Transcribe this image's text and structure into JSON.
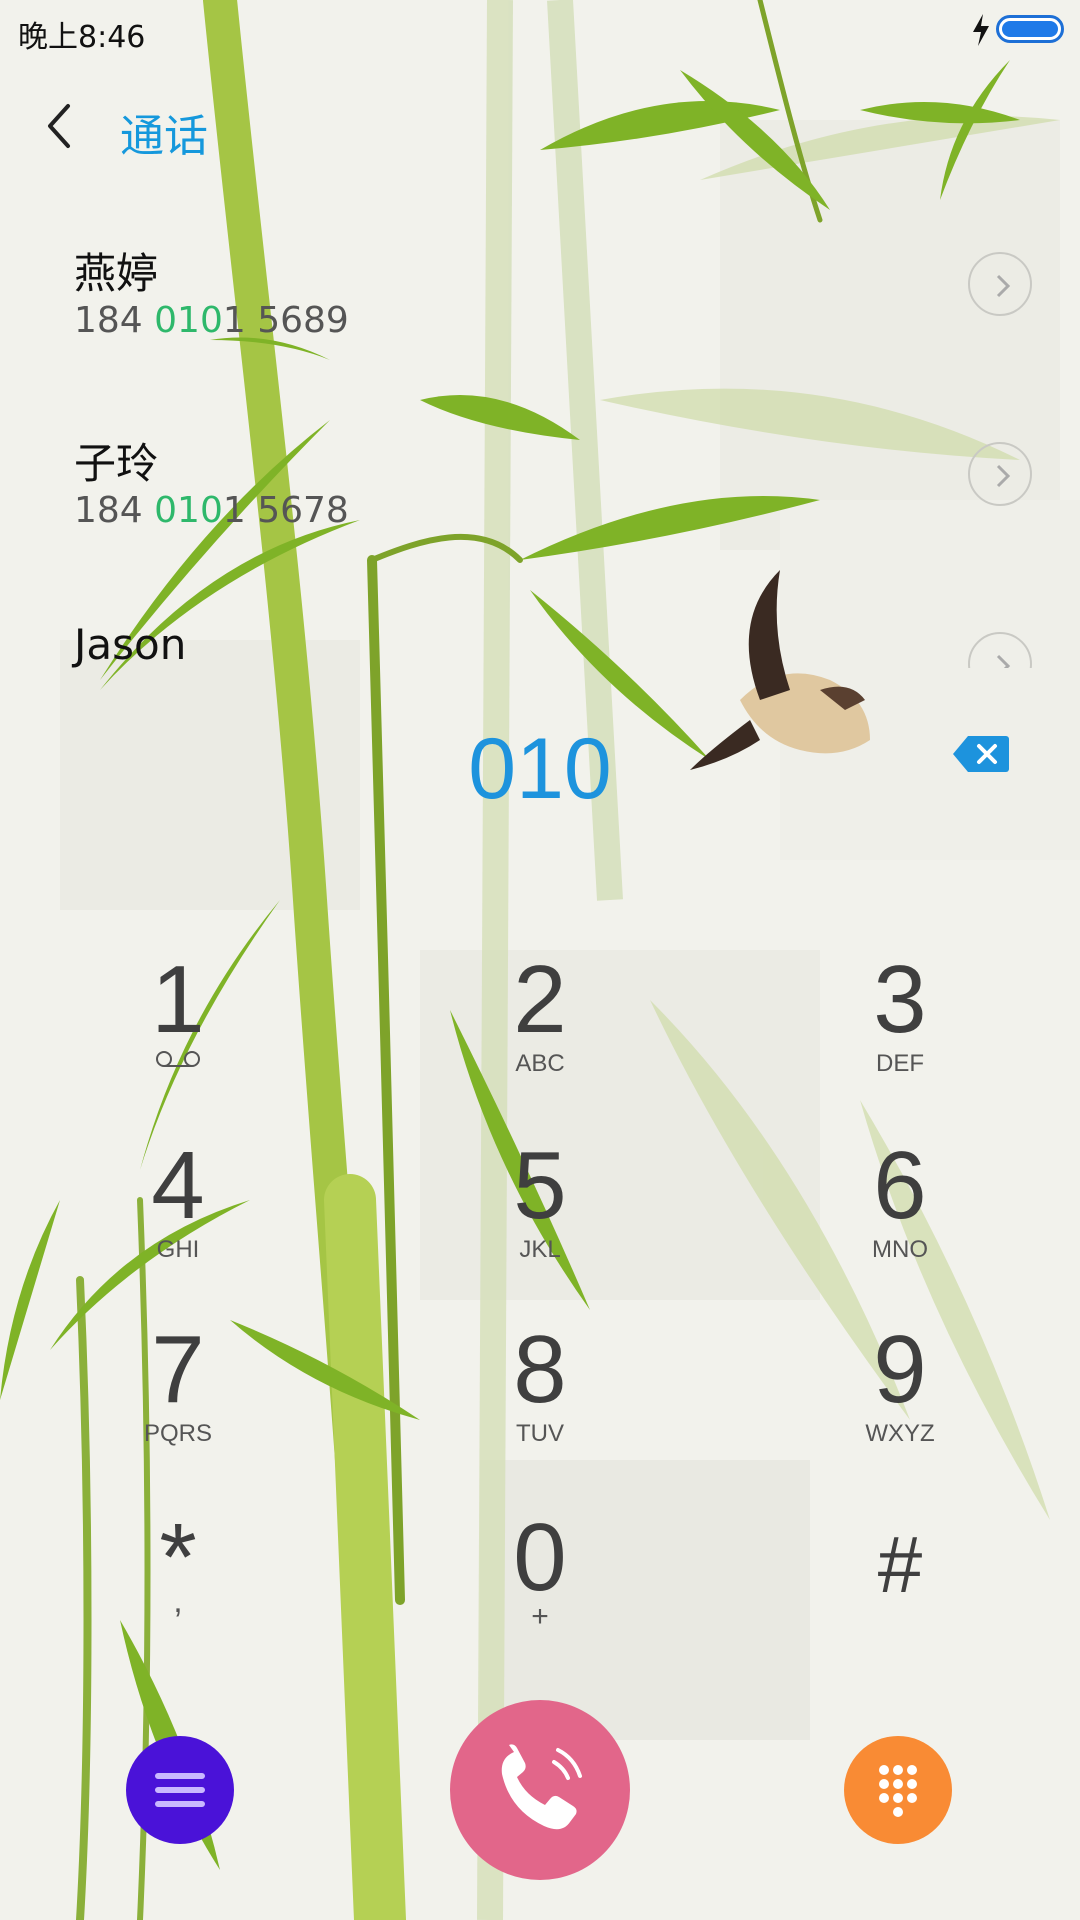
{
  "status_bar": {
    "time": "晚上8:46",
    "battery_color": "#1f7ae8"
  },
  "header": {
    "back_icon": "chevron-left-icon",
    "title": "通话",
    "accent": "#1598dc"
  },
  "contacts": [
    {
      "name": "燕婷",
      "number_pre": "184 ",
      "number_match": "010",
      "number_post": "1 5689"
    },
    {
      "name": "子玲",
      "number_pre": "184 ",
      "number_match": "010",
      "number_post": "1 5678"
    },
    {
      "name": "Jason"
    }
  ],
  "dialer": {
    "input": "010",
    "backspace_icon": "backspace-icon",
    "keys": [
      {
        "digit": "1",
        "letters": "",
        "icon": "voicemail-icon"
      },
      {
        "digit": "2",
        "letters": "ABC"
      },
      {
        "digit": "3",
        "letters": "DEF"
      },
      {
        "digit": "4",
        "letters": "GHI"
      },
      {
        "digit": "5",
        "letters": "JKL"
      },
      {
        "digit": "6",
        "letters": "MNO"
      },
      {
        "digit": "7",
        "letters": "PQRS"
      },
      {
        "digit": "8",
        "letters": "TUV"
      },
      {
        "digit": "9",
        "letters": "WXYZ"
      },
      {
        "digit": "*",
        "letters": ","
      },
      {
        "digit": "0",
        "letters": "+"
      },
      {
        "digit": "#",
        "letters": ""
      }
    ]
  },
  "bottom_bar": {
    "menu_icon": "menu-icon",
    "menu_color": "#4a12d8",
    "call_icon": "phone-icon",
    "call_color": "#e2668a",
    "keypad_icon": "dialpad-icon",
    "keypad_color": "#f98b34"
  }
}
